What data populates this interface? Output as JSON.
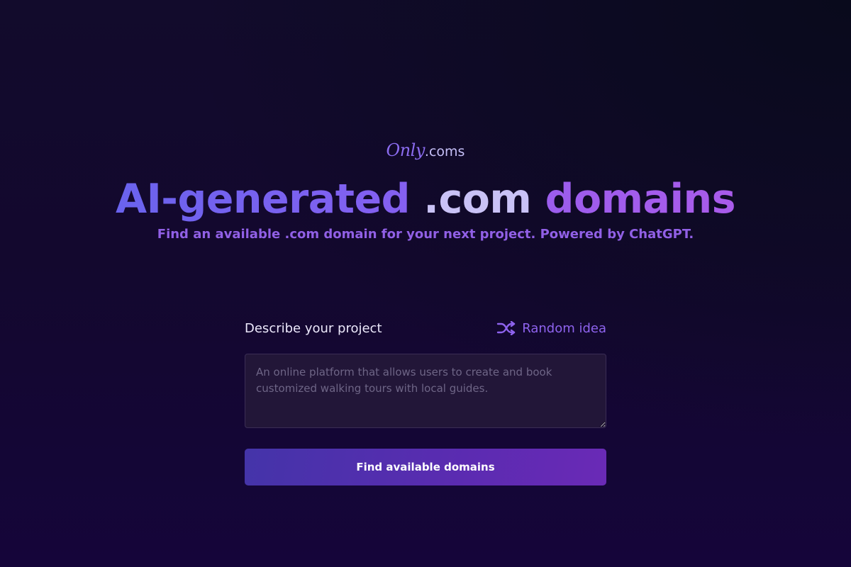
{
  "logo": {
    "script_text": "Only",
    "suffix_text": ".coms"
  },
  "hero": {
    "headline_part1": "AI-generated",
    "headline_part2": ".com",
    "headline_part3": "domains",
    "subheadline": "Find an available .com domain for your next project. Powered by ChatGPT."
  },
  "form": {
    "label": "Describe your project",
    "random_idea_label": "Random idea",
    "random_idea_icon": "shuffle-icon",
    "input_placeholder": "An online platform that allows users to create and book customized walking tours with local guides.",
    "input_value": "",
    "submit_label": "Find available domains"
  },
  "colors": {
    "accent_purple": "#8e63ee",
    "headline_light": "#c9c2f6",
    "button_start": "#4434a9",
    "button_end": "#6a2ab6",
    "background": "#13082e"
  }
}
